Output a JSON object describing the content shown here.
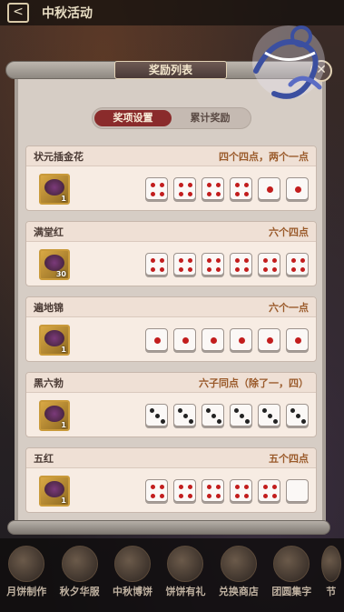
{
  "topbar": {
    "title": "中秋活动",
    "back_icon": "back-icon"
  },
  "modal": {
    "title": "奖励列表",
    "close_icon": "close-icon",
    "logo_icon": "mid-autumn-gift-logo",
    "tabs": [
      {
        "label": "奖项设置",
        "active": true
      },
      {
        "label": "累计奖励",
        "active": false
      }
    ],
    "prizes": [
      {
        "name": "状元插金花",
        "condition": "四个四点，两个一点",
        "reward_count": "1",
        "dice": [
          4,
          4,
          4,
          4,
          1,
          1
        ]
      },
      {
        "name": "满堂红",
        "condition": "六个四点",
        "reward_count": "30",
        "dice": [
          4,
          4,
          4,
          4,
          4,
          4
        ]
      },
      {
        "name": "遍地锦",
        "condition": "六个一点",
        "reward_count": "1",
        "dice": [
          1,
          1,
          1,
          1,
          1,
          1
        ]
      },
      {
        "name": "黑六勃",
        "condition": "六子同点（除了一，四）",
        "reward_count": "1",
        "dice": [
          3,
          3,
          3,
          3,
          3,
          3
        ]
      },
      {
        "name": "五红",
        "condition": "五个四点",
        "reward_count": "1",
        "dice": [
          4,
          4,
          4,
          4,
          4,
          0
        ]
      }
    ]
  },
  "bottom_nav": [
    {
      "label": "月饼制作"
    },
    {
      "label": "秋夕华服"
    },
    {
      "label": "中秋博饼"
    },
    {
      "label": "饼饼有礼"
    },
    {
      "label": "兑换商店"
    },
    {
      "label": "团圆集字"
    },
    {
      "label": "节"
    }
  ],
  "colors": {
    "accent": "#8a2b2b",
    "condition_text": "#9a5a2a",
    "pip_red": "#c21d1d",
    "pip_black": "#222222"
  }
}
